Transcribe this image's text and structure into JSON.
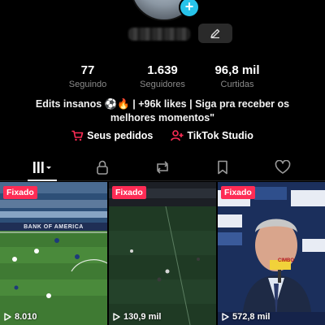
{
  "profile": {
    "username": "username",
    "stats": [
      {
        "value": "77",
        "label": "Seguindo"
      },
      {
        "value": "1.639",
        "label": "Seguidores"
      },
      {
        "value": "96,8 mil",
        "label": "Curtidas"
      }
    ],
    "bio": "Edits insanos ⚽🔥 | +96k likes | Siga pra receber os melhores momentos\""
  },
  "links": {
    "orders": "Seus pedidos",
    "studio": "TikTok Studio"
  },
  "videos": [
    {
      "pinned_label": "Fixado",
      "views": "8.010",
      "banner": "BANK OF AMERICA"
    },
    {
      "pinned_label": "Fixado",
      "views": "130,9 mil"
    },
    {
      "pinned_label": "Fixado",
      "views": "572,8 mil",
      "sign": "CIMBO"
    }
  ],
  "colors": {
    "accent": "#fe2c55",
    "badge": "#27c3ea"
  }
}
